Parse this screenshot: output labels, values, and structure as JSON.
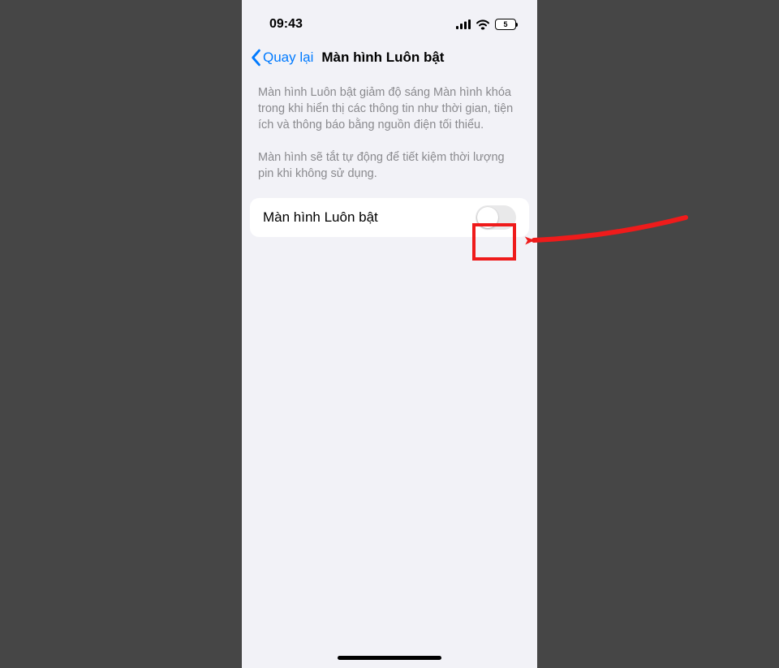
{
  "status": {
    "time": "09:43",
    "battery": "5"
  },
  "nav": {
    "back": "Quay lại",
    "title": "Màn hình Luôn bật"
  },
  "description": {
    "p1": "Màn hình Luôn bật giảm độ sáng Màn hình khóa trong khi hiển thị các thông tin như thời gian, tiện ích và thông báo bằng nguồn điện tối thiểu.",
    "p2": "Màn hình sẽ tắt tự động để tiết kiệm thời lượng pin khi không sử dụng."
  },
  "setting": {
    "label": "Màn hình Luôn bật",
    "enabled": false
  }
}
